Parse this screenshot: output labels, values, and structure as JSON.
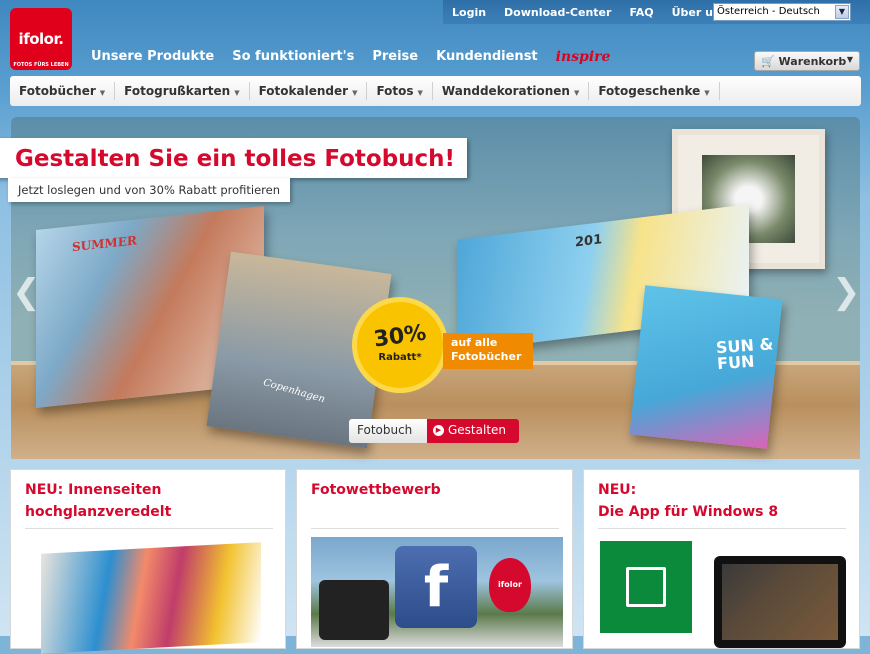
{
  "brand": {
    "logo_text": "ifolor.",
    "tagline": "FOTOS FÜRS LEBEN",
    "color": "#e0001b"
  },
  "topbar": {
    "links": [
      "Login",
      "Download-Center",
      "FAQ",
      "Über uns"
    ],
    "country_select": "Österreich - Deutsch"
  },
  "mainnav": {
    "items": [
      "Unsere Produkte",
      "So funktioniert's",
      "Preise",
      "Kundendienst"
    ],
    "inspire": "inspire",
    "cart": "Warenkorb"
  },
  "subnav": {
    "items": [
      "Fotobücher",
      "Fotogrußkarten",
      "Fotokalender",
      "Fotos",
      "Wanddekorationen",
      "Fotogeschenke"
    ]
  },
  "hero": {
    "title": "Gestalten Sie ein tolles Fotobuch!",
    "subtitle": "Jetzt loslegen und von 30% Rabatt profitieren",
    "book1_text": "SUMMER",
    "book2_text": "Copenhagen",
    "book3_text": "201",
    "book4_text": "SUN & FUN",
    "badge_pct": "30%",
    "badge_label": "Rabatt*",
    "promo_line1": "auf alle",
    "promo_line2": "Fotobücher",
    "tab_label": "Fotobuch",
    "cta_label": "Gestalten"
  },
  "cards": [
    {
      "title_line1": "NEU: Innenseiten",
      "title_line2": "hochglanzveredelt"
    },
    {
      "title_line1": "Fotowettbewerb",
      "title_line2": "",
      "balloon": "ifolor"
    },
    {
      "title_line1": "NEU:",
      "title_line2": "Die App für Windows 8"
    }
  ],
  "colors": {
    "accent": "#d5082d",
    "promo": "#f08a00",
    "badge": "#f9c300"
  }
}
